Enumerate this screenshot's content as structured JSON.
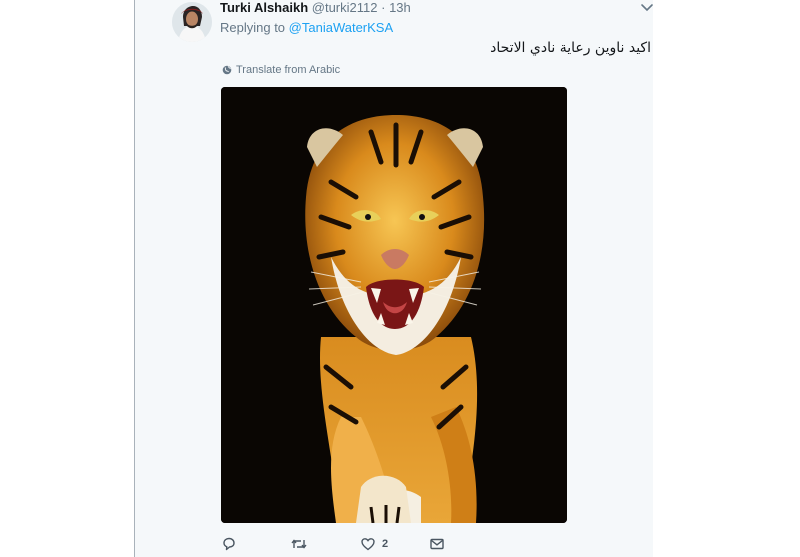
{
  "tweet": {
    "author_name": "Turki Alshaikh",
    "handle": "@turki2112",
    "separator": "·",
    "time": "13h",
    "replying_prefix": "Replying to",
    "replying_to": "@TaniaWaterKSA",
    "text": "اكيد ناوين رعاية نادي الاتحاد",
    "translate_label": "Translate from Arabic",
    "likes": "2"
  },
  "icons": {
    "menu": "chevron-down-icon",
    "translate": "globe-icon",
    "reply": "reply-icon",
    "retweet": "retweet-icon",
    "like": "heart-icon",
    "dm": "envelope-icon"
  },
  "colors": {
    "link": "#1da1f2",
    "secondary_text": "#657786",
    "background": "#f5f8fa"
  }
}
